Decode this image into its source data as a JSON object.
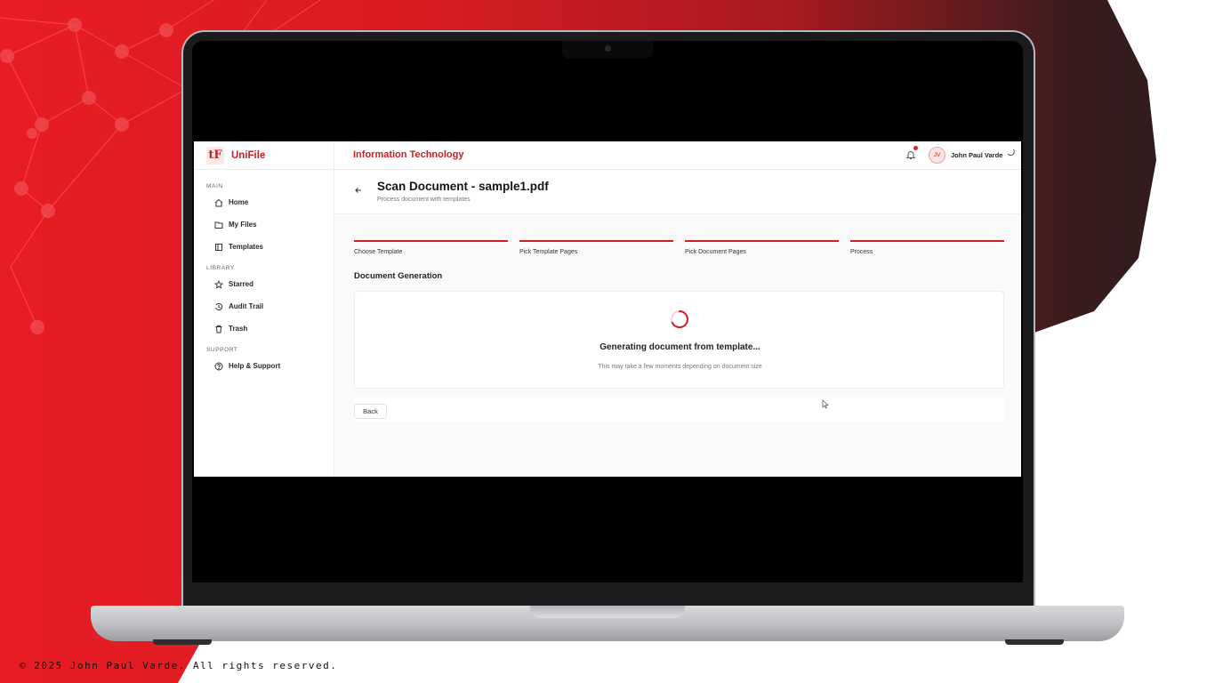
{
  "app": {
    "brand_logo": "tF",
    "brand_name": "UniFile",
    "department": "Information Technology",
    "user_initials": "JV",
    "user_name": "John Paul Varde"
  },
  "sidebar": {
    "sections": [
      {
        "title": "MAIN",
        "items": [
          "Home",
          "My Files",
          "Templates"
        ]
      },
      {
        "title": "LIBRARY",
        "items": [
          "Starred",
          "Audit Trail",
          "Trash"
        ]
      },
      {
        "title": "SUPPORT",
        "items": [
          "Help & Support"
        ]
      }
    ],
    "icons": [
      "home-icon",
      "folder-icon",
      "template-icon",
      "star-icon",
      "history-icon",
      "trash-icon",
      "help-icon"
    ]
  },
  "page": {
    "title": "Scan Document - sample1.pdf",
    "subtitle": "Process document with templates"
  },
  "steps": [
    "Choose Template",
    "Pick Template Pages",
    "Pick Document Pages",
    "Process"
  ],
  "generation": {
    "heading": "Document Generation",
    "message": "Generating document from template...",
    "note": "This may take a few moments depending on document size"
  },
  "actions": {
    "back_label": "Back"
  },
  "footer": {
    "copyright": "© 2025 John Paul Varde. All rights reserved."
  },
  "colors": {
    "accent": "#c81e25",
    "background_red": "#e81c24"
  }
}
